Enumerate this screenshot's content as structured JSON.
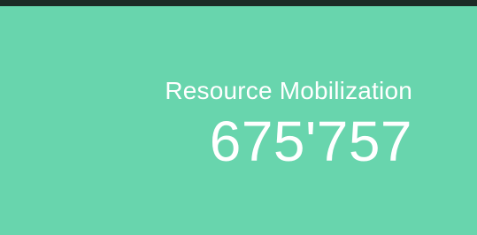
{
  "colors": {
    "background": "#68d5ad",
    "top_bar": "#1c2b26",
    "text": "#ffffff"
  },
  "stat": {
    "label": "Resource Mobilization",
    "value": "675'757"
  }
}
